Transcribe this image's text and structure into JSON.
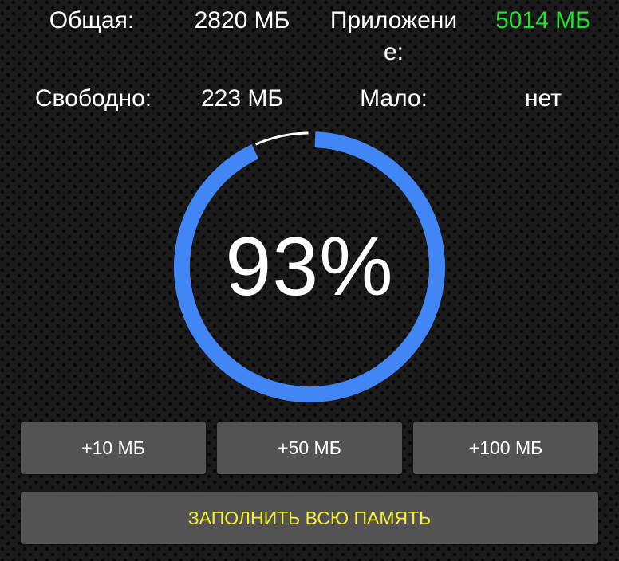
{
  "stats": {
    "total_label": "Общая:",
    "total_value": "2820 МБ",
    "app_label": "Приложение:",
    "app_value": "5014 МБ",
    "free_label": "Свободно:",
    "free_value": "223 МБ",
    "low_label": "Мало:",
    "low_value": "нет"
  },
  "gauge": {
    "percent_text": "93%",
    "fraction": 0.93
  },
  "buttons": {
    "add10": "+10 МБ",
    "add50": "+50 МБ",
    "add100": "+100 МБ",
    "fill_all": "ЗАПОЛНИТЬ ВСЮ ПАМЯТЬ"
  },
  "colors": {
    "accent": "#4285f4",
    "app_value": "#22e02f",
    "fill_button_text": "#f4f02e",
    "button_bg": "#535353",
    "track": "#ffffff"
  }
}
